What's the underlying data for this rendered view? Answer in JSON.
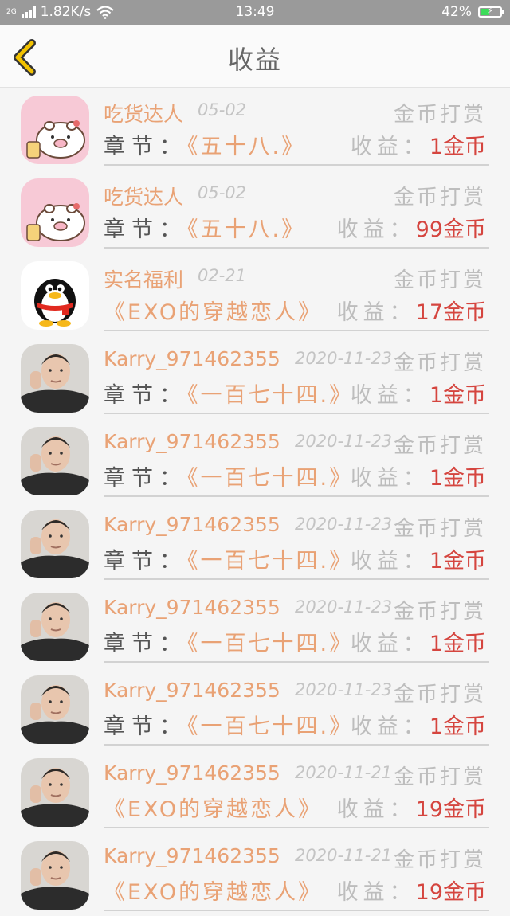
{
  "status_bar": {
    "network_type": "2G",
    "speed": "1.82K/s",
    "time": "13:49",
    "battery": "42%",
    "battery_level": 0.42,
    "icons": [
      "signal-icon",
      "wifi-icon",
      "battery-charging-icon"
    ]
  },
  "header": {
    "title": "收益",
    "back_icon": "chevron-left-icon"
  },
  "rows": [
    {
      "avatar": "pig-avatar",
      "name": "吃货达人",
      "date": "05-02",
      "type": "金币打赏",
      "chapter_label": "章节：",
      "chapter_title": "《五十八.》",
      "earn_label": "收益：",
      "amount": "1金币"
    },
    {
      "avatar": "pig-avatar",
      "name": "吃货达人",
      "date": "05-02",
      "type": "金币打赏",
      "chapter_label": "章节：",
      "chapter_title": "《五十八.》",
      "earn_label": "收益：",
      "amount": "99金币"
    },
    {
      "avatar": "penguin-avatar",
      "name": "实名福利",
      "date": "02-21",
      "type": "金币打赏",
      "chapter_label": "",
      "chapter_title": "《EXO的穿越恋人》",
      "earn_label": "收益：",
      "amount": "17金币"
    },
    {
      "avatar": "person-avatar",
      "name": "Karry_971462355",
      "date": "2020-11-23",
      "type": "金币打赏",
      "chapter_label": "章节：",
      "chapter_title": "《一百七十四.》",
      "earn_label": "收益：",
      "amount": "1金币"
    },
    {
      "avatar": "person-avatar",
      "name": "Karry_971462355",
      "date": "2020-11-23",
      "type": "金币打赏",
      "chapter_label": "章节：",
      "chapter_title": "《一百七十四.》",
      "earn_label": "收益：",
      "amount": "1金币"
    },
    {
      "avatar": "person-avatar",
      "name": "Karry_971462355",
      "date": "2020-11-23",
      "type": "金币打赏",
      "chapter_label": "章节：",
      "chapter_title": "《一百七十四.》",
      "earn_label": "收益：",
      "amount": "1金币"
    },
    {
      "avatar": "person-avatar",
      "name": "Karry_971462355",
      "date": "2020-11-23",
      "type": "金币打赏",
      "chapter_label": "章节：",
      "chapter_title": "《一百七十四.》",
      "earn_label": "收益：",
      "amount": "1金币"
    },
    {
      "avatar": "person-avatar",
      "name": "Karry_971462355",
      "date": "2020-11-23",
      "type": "金币打赏",
      "chapter_label": "章节：",
      "chapter_title": "《一百七十四.》",
      "earn_label": "收益：",
      "amount": "1金币"
    },
    {
      "avatar": "person-avatar",
      "name": "Karry_971462355",
      "date": "2020-11-21",
      "type": "金币打赏",
      "chapter_label": "",
      "chapter_title": "《EXO的穿越恋人》",
      "earn_label": "收益：",
      "amount": "19金币"
    },
    {
      "avatar": "person-avatar",
      "name": "Karry_971462355",
      "date": "2020-11-21",
      "type": "金币打赏",
      "chapter_label": "",
      "chapter_title": "《EXO的穿越恋人》",
      "earn_label": "收益：",
      "amount": "19金币"
    }
  ],
  "colors": {
    "accent_orange": "#e9a275",
    "amount_red": "#d5453f",
    "back_yellow": "#f2c200",
    "status_bar": "#9a9a9a"
  }
}
